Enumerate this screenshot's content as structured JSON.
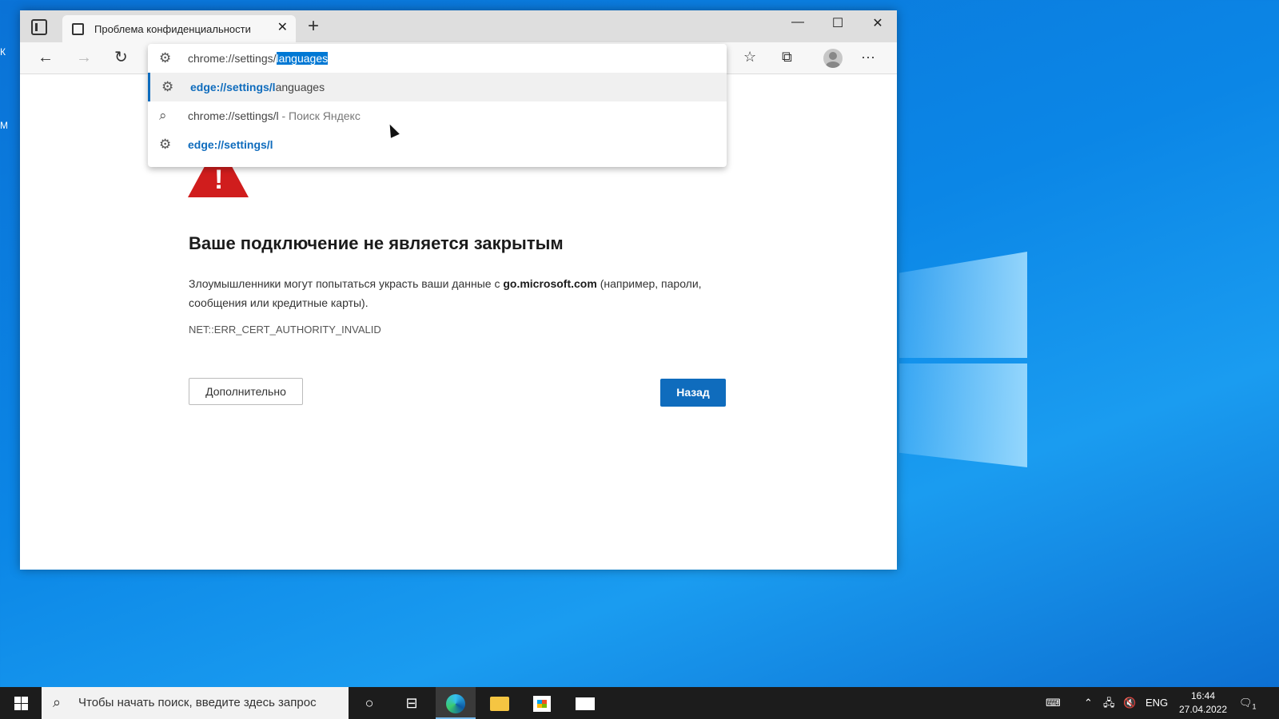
{
  "desktop": {
    "icon_label_1": "К",
    "icon_label_2": "М"
  },
  "browser": {
    "tab": {
      "title": "Проблема конфиденциальности"
    },
    "new_tab_label": "+",
    "window_controls": {
      "minimize": "—",
      "maximize": "☐",
      "close": "✕"
    },
    "address": {
      "prefix": "chrome://settings/",
      "selected": "languages"
    },
    "suggestions": [
      {
        "icon": "gear-icon",
        "bold": "edge://settings/l",
        "rest": "anguages"
      },
      {
        "icon": "search-icon",
        "text": "chrome://settings/l",
        "suffix": " - Поиск Яндекс"
      },
      {
        "icon": "gear-icon",
        "bold": "edge://settings/l",
        "rest": ""
      }
    ]
  },
  "page": {
    "heading": "Ваше подключение не является закрытым",
    "desc_before": "Злоумышленники могут попытаться украсть ваши данные с ",
    "desc_domain": "go.microsoft.com",
    "desc_after": " (например, пароли, сообщения или кредитные карты).",
    "error_code": "NET::ERR_CERT_AUTHORITY_INVALID",
    "advanced_button": "Дополнительно",
    "back_button": "Назад"
  },
  "taskbar": {
    "search_placeholder": "Чтобы начать поиск, введите здесь запрос",
    "language": "ENG",
    "time": "16:44",
    "date": "27.04.2022",
    "notification_count": "1"
  },
  "colors": {
    "accent": "#0f6cbd",
    "warning": "#d01d1d",
    "desktop": "#0b86e6"
  }
}
